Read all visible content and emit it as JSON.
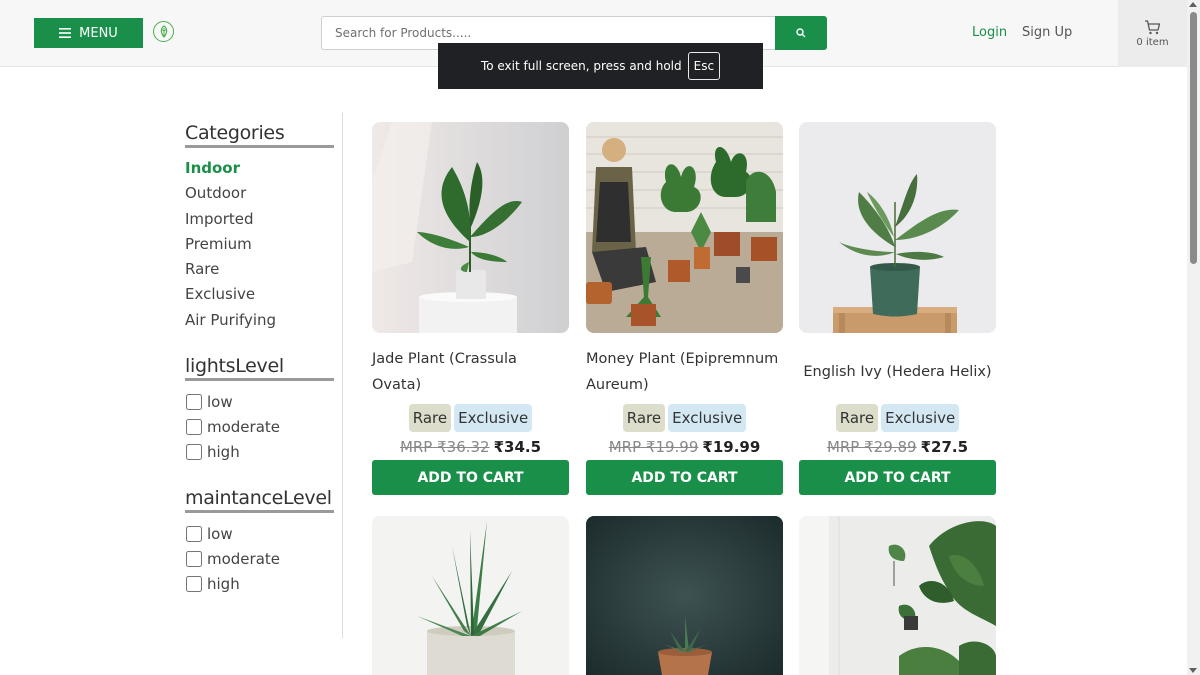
{
  "header": {
    "menu_label": "MENU",
    "search_placeholder": "Search for Products.....",
    "login_label": "Login",
    "signup_label": "Sign Up",
    "cart_count": "0 item"
  },
  "fullscreen_notice": {
    "text": "To exit full screen, press and hold",
    "key": "Esc"
  },
  "sidebar": {
    "categories_title": "Categories",
    "categories": [
      "Indoor",
      "Outdoor",
      "Imported",
      "Premium",
      "Rare",
      "Exclusive",
      "Air Purifying"
    ],
    "active_category": "Indoor",
    "lights_title": "lightsLevel",
    "lights_options": [
      "low",
      "moderate",
      "high"
    ],
    "maintenance_title": "maintanceLevel",
    "maintenance_options": [
      "low",
      "moderate",
      "high"
    ]
  },
  "products": [
    {
      "name": "Jade Plant (Crassula Ovata)",
      "tags": [
        "Rare",
        "Exclusive"
      ],
      "mrp": "MRP ₹36.32",
      "price": "₹34.5",
      "button": "ADD TO CART"
    },
    {
      "name": "Money Plant (Epipremnum Aureum)",
      "tags": [
        "Rare",
        "Exclusive"
      ],
      "mrp": "MRP ₹19.99",
      "price": "₹19.99",
      "button": "ADD TO CART"
    },
    {
      "name": "English Ivy (Hedera Helix)",
      "tags": [
        "Rare",
        "Exclusive"
      ],
      "mrp": "MRP ₹29.89",
      "price": "₹27.5",
      "button": "ADD TO CART"
    }
  ],
  "colors": {
    "brand_green": "#1a8f4a",
    "rare_tag_bg": "#dcdecb",
    "exclusive_tag_bg": "#d4e8f4"
  }
}
